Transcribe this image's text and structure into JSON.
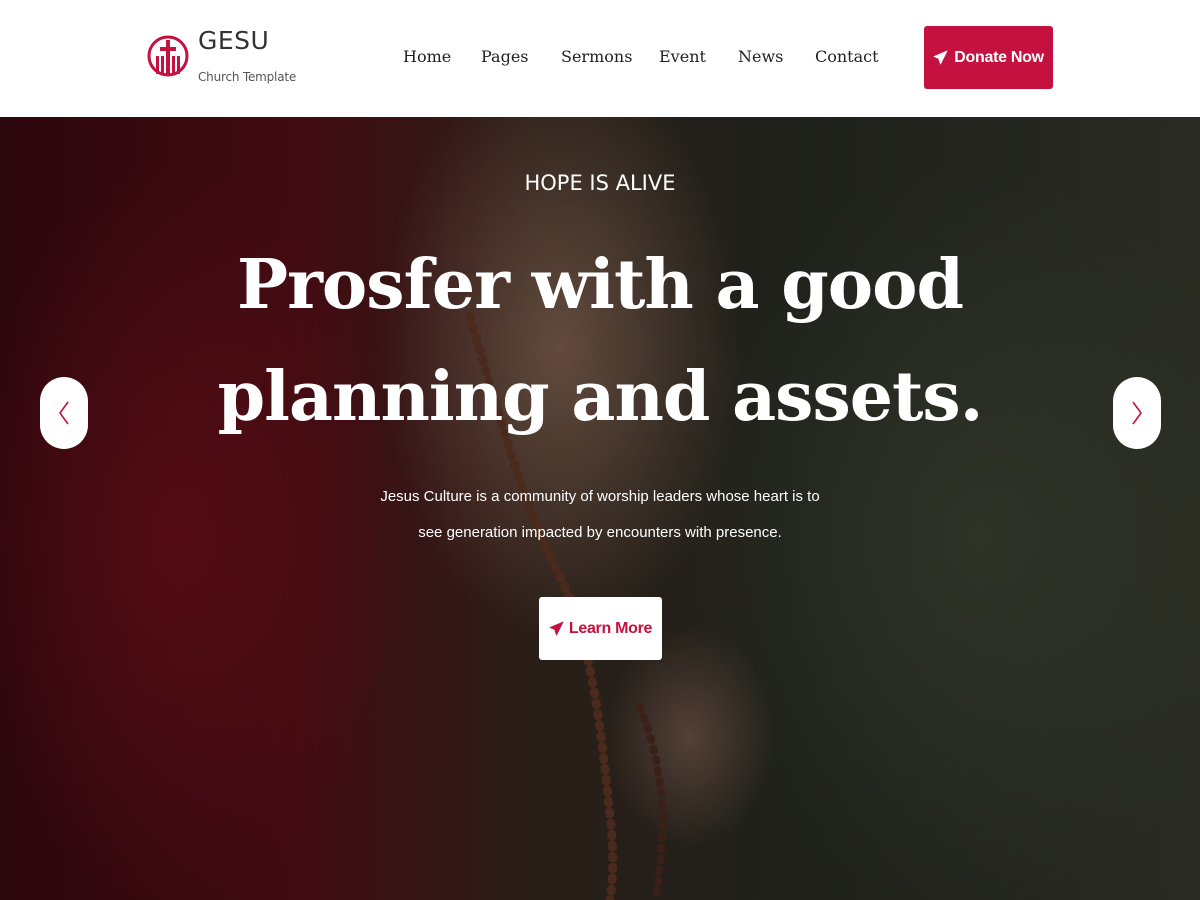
{
  "brand": {
    "name": "GESU",
    "tagline": "Church Template",
    "logo_icon": "cross-church-icon"
  },
  "nav": {
    "items": [
      {
        "label": "Home"
      },
      {
        "label": "Pages"
      },
      {
        "label": "Sermons"
      },
      {
        "label": "Event"
      },
      {
        "label": "News"
      },
      {
        "label": "Contact"
      }
    ],
    "donate_label": "Donate Now",
    "donate_icon": "paper-plane-icon"
  },
  "hero": {
    "kicker": "HOPE IS ALIVE",
    "title_line1": "Prosfer with a good",
    "title_line2": "planning and assets.",
    "text_line1": "Jesus Culture is a community of worship leaders whose heart is to",
    "text_line2": "see generation impacted by encounters with presence.",
    "button_label": "Learn More",
    "button_icon": "paper-plane-icon",
    "prev_icon": "chevron-left-icon",
    "next_icon": "chevron-right-icon"
  },
  "colors": {
    "accent": "#c4113f",
    "white": "#ffffff",
    "nav_text": "#222222"
  }
}
